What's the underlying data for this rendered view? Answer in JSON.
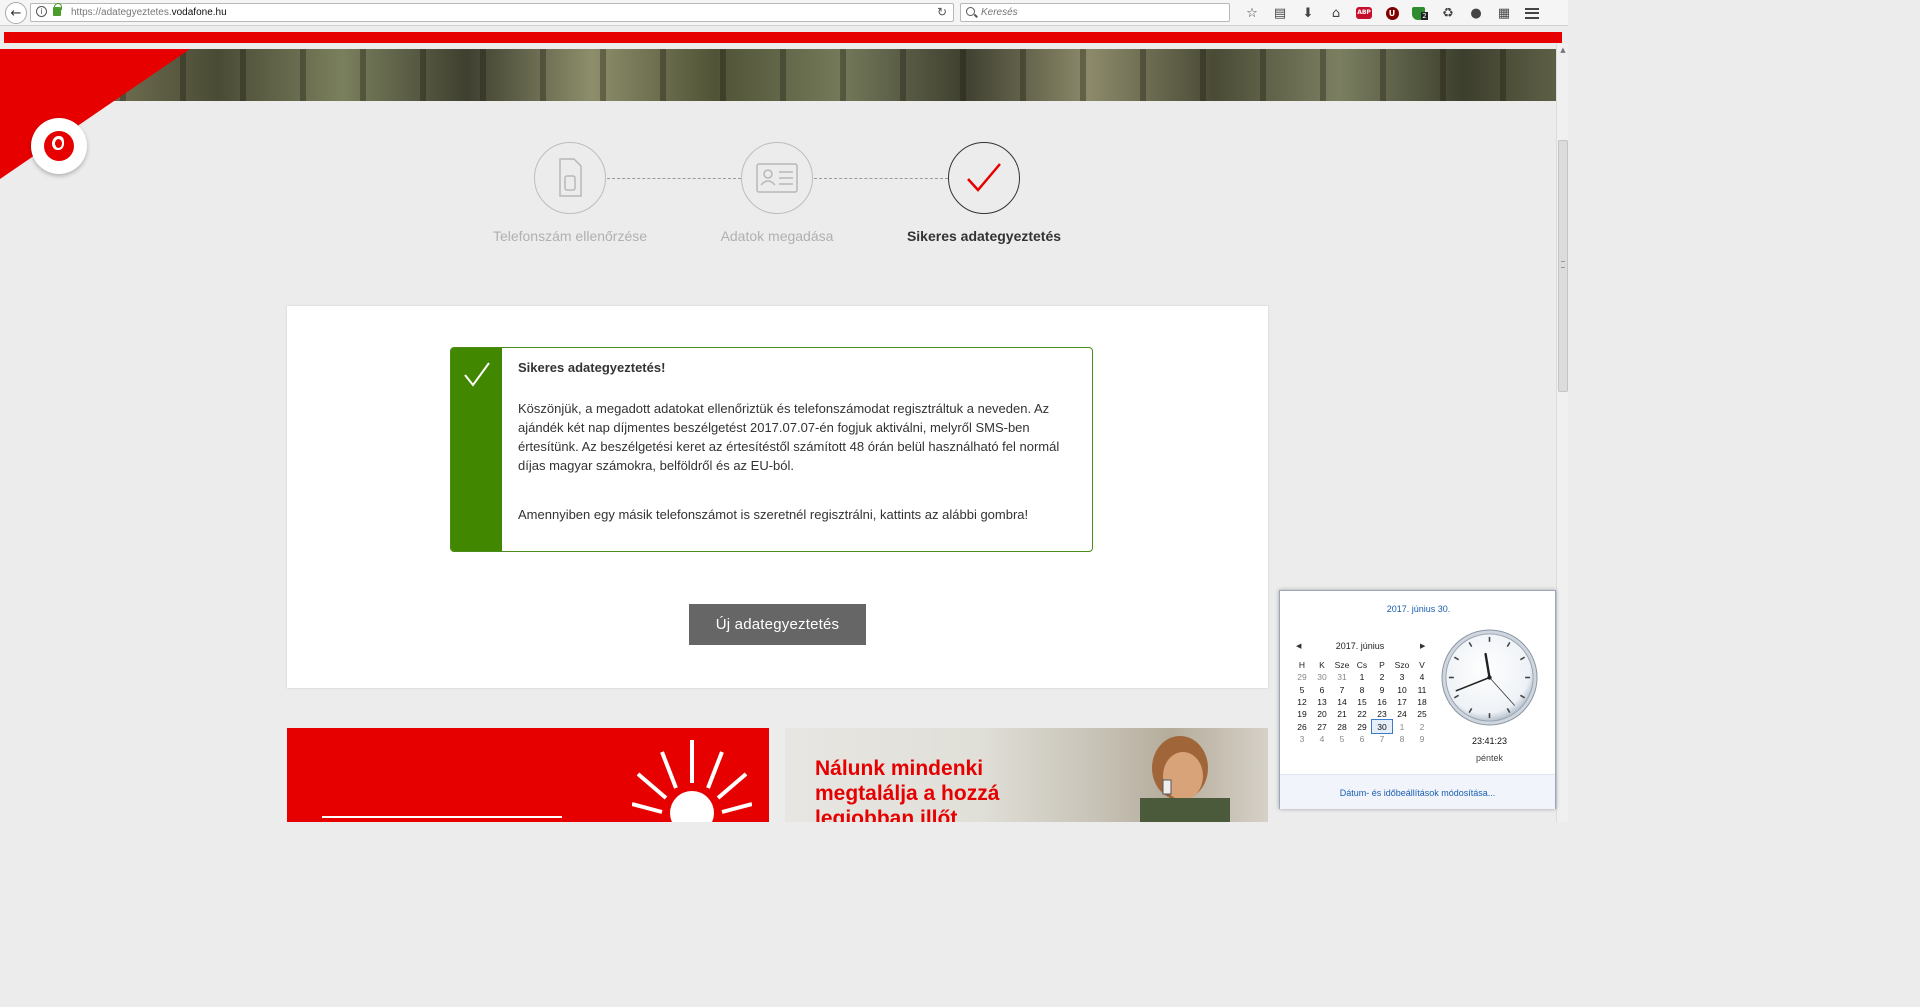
{
  "browser": {
    "url_prefix": "https://adategyeztetes.",
    "url_host": "vodafone.hu",
    "search_placeholder": "Keresés",
    "toolbar_icons": [
      "star-icon",
      "reading-list-icon",
      "download-icon",
      "home-icon",
      "adblock-icon",
      "ublock-icon",
      "shield-icon",
      "sync-icon",
      "lightbulb-icon",
      "translate-icon",
      "menu-icon"
    ],
    "ublock_letter": "U",
    "adblock_label": "ABP",
    "shield_badge": "2"
  },
  "steps": [
    {
      "label": "Telefonszám ellenőrzése",
      "state": "done",
      "icon": "sim-card-icon"
    },
    {
      "label": "Adatok megadása",
      "state": "done",
      "icon": "id-card-icon"
    },
    {
      "label": "Sikeres adategyeztetés",
      "state": "active",
      "icon": "check-icon"
    }
  ],
  "success": {
    "title": "Sikeres adategyeztetés!",
    "paragraph1": "Köszönjük, a megadott adatokat ellenőriztük és telefonszámodat regisztráltuk a neveden. Az ajándék két nap díjmentes beszélgetést 2017.07.07-én fogjuk aktiválni, melyről SMS-ben értesítünk. Az beszélgetési keret az értesítéstől számított 48 órán belül használható fel normál díjas magyar számokra, belföldről és az EU-ból.",
    "paragraph2": "Amennyiben egy másik telefonszámot is szeretnél regisztrálni, kattints az alábbi gombra!"
  },
  "new_button_label": "Új adategyeztetés",
  "promo": {
    "text_line1": "Nálunk mindenki",
    "text_line2": "megtalálja a hozzá",
    "text_line3": "legjobban illőt"
  },
  "clock_popup": {
    "full_date": "2017. június 30.",
    "month_label": "2017. június",
    "weekday_headers": [
      "H",
      "K",
      "Sze",
      "Cs",
      "P",
      "Szo",
      "V"
    ],
    "weeks": [
      [
        "29",
        "30",
        "31",
        "1",
        "2",
        "3",
        "4"
      ],
      [
        "5",
        "6",
        "7",
        "8",
        "9",
        "10",
        "11"
      ],
      [
        "12",
        "13",
        "14",
        "15",
        "16",
        "17",
        "18"
      ],
      [
        "19",
        "20",
        "21",
        "22",
        "23",
        "24",
        "25"
      ],
      [
        "26",
        "27",
        "28",
        "29",
        "30",
        "1",
        "2"
      ],
      [
        "3",
        "4",
        "5",
        "6",
        "7",
        "8",
        "9"
      ]
    ],
    "today": "30",
    "time": "23:41:23",
    "day_name": "péntek",
    "settings_link": "Dátum- és időbeállítások módosítása..."
  },
  "colors": {
    "brand_red": "#e60000",
    "success_green": "#428700",
    "button_gray": "#666666",
    "link_blue": "#1a5eb0"
  }
}
